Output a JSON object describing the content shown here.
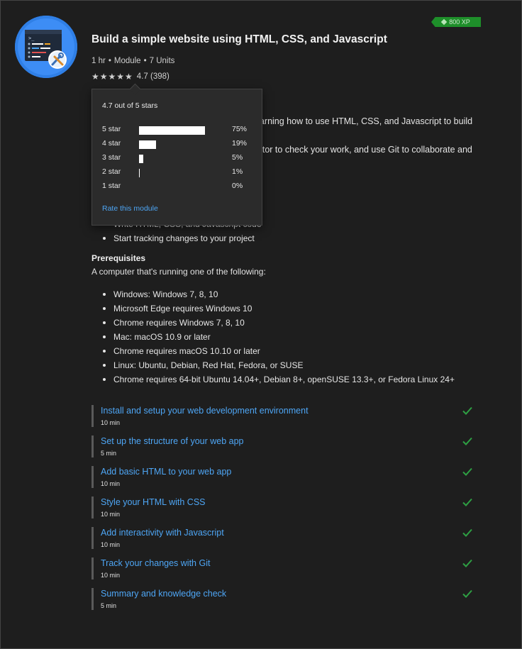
{
  "module": {
    "title": "Build a simple website using HTML, CSS, and Javascript",
    "duration": "1 hr",
    "type": "Module",
    "units": "7 Units",
    "rating_value": "4.7",
    "rating_count": "(398)",
    "xp": "800 XP"
  },
  "description": {
    "line1": "Learn the basics of web development by learning how to use HTML, CSS, and Javascript to build a",
    "line2": "simple website. Use Visual Studio Code editor to check your work, and use Git to collaborate and"
  },
  "learn_items": [
    "Write HTML, CSS, and Javascript code",
    "Start tracking changes to your project"
  ],
  "prerequisites": {
    "title": "Prerequisites",
    "intro": "A computer that's running one of the following:",
    "items": [
      "Windows: Windows 7, 8, 10",
      "Microsoft Edge requires Windows 10",
      "Chrome requires Windows 7, 8, 10",
      "Mac: macOS 10.9 or later",
      "Chrome requires macOS 10.10 or later",
      "Linux: Ubuntu, Debian, Red Hat, Fedora, or SUSE",
      "Chrome requires 64-bit Ubuntu 14.04+, Debian 8+, openSUSE 13.3+, or Fedora Linux 24+"
    ]
  },
  "units": [
    {
      "title": "Install and setup your web development environment",
      "time": "10 min",
      "completed": true
    },
    {
      "title": "Set up the structure of your web app",
      "time": "5 min",
      "completed": true
    },
    {
      "title": "Add basic HTML to your web app",
      "time": "10 min",
      "completed": true
    },
    {
      "title": "Style your HTML with CSS",
      "time": "10 min",
      "completed": true
    },
    {
      "title": "Add interactivity with Javascript",
      "time": "10 min",
      "completed": true
    },
    {
      "title": "Track your changes with Git",
      "time": "10 min",
      "completed": true
    },
    {
      "title": "Summary and knowledge check",
      "time": "5 min",
      "completed": true
    }
  ],
  "rating_popover": {
    "headline": "4.7 out of 5 stars",
    "rows": [
      {
        "label": "5 star",
        "percent": "75%",
        "fraction": 0.75
      },
      {
        "label": "4 star",
        "percent": "19%",
        "fraction": 0.19
      },
      {
        "label": "3 star",
        "percent": "5%",
        "fraction": 0.05
      },
      {
        "label": "2 star",
        "percent": "1%",
        "fraction": 0.01
      },
      {
        "label": "1 star",
        "percent": "0%",
        "fraction": 0.0
      }
    ],
    "rate_link": "Rate this module"
  },
  "colors": {
    "accent_link": "#4ea6f5",
    "check_green": "#2ea043",
    "xp_green": "#1e8f2a",
    "icon_blue": "#3d8df5"
  },
  "icons": {
    "hero": "code-editor-tools-icon",
    "check": "checkmark-icon",
    "star": "star-icon",
    "xp": "xp-diamond-icon"
  }
}
